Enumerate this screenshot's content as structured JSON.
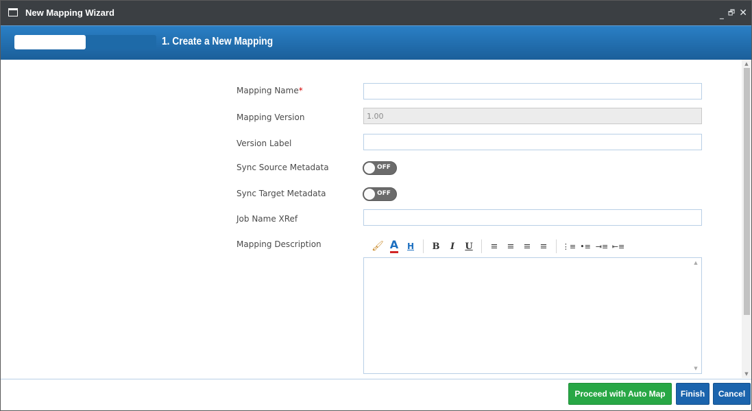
{
  "window": {
    "title": "New Mapping Wizard",
    "controls": {
      "minimize": "_",
      "restore": "🗗",
      "close": "✕"
    }
  },
  "wizard": {
    "step_title": "1. Create a New Mapping",
    "progress_fraction": 0.5
  },
  "form": {
    "mapping_name": {
      "label": "Mapping Name",
      "required_mark": "*",
      "value": ""
    },
    "mapping_version": {
      "label": "Mapping Version",
      "value": "1.00"
    },
    "version_label": {
      "label": "Version Label",
      "value": ""
    },
    "sync_source": {
      "label": "Sync Source Metadata",
      "state": "OFF"
    },
    "sync_target": {
      "label": "Sync Target Metadata",
      "state": "OFF"
    },
    "job_name_xref": {
      "label": "Job Name XRef",
      "value": ""
    },
    "mapping_description": {
      "label": "Mapping Description",
      "value": ""
    }
  },
  "editor_toolbar": {
    "buttons": [
      {
        "name": "paint-format-icon",
        "glyph": "🖌"
      },
      {
        "name": "font-color-icon",
        "glyph": "A"
      },
      {
        "name": "highlight-icon",
        "glyph": "H"
      },
      {
        "name": "bold-icon",
        "glyph": "B"
      },
      {
        "name": "italic-icon",
        "glyph": "I"
      },
      {
        "name": "underline-icon",
        "glyph": "U"
      },
      {
        "name": "align-left-icon",
        "glyph": "≡"
      },
      {
        "name": "align-center-icon",
        "glyph": "≡"
      },
      {
        "name": "align-right-icon",
        "glyph": "≡"
      },
      {
        "name": "justify-icon",
        "glyph": "≡"
      },
      {
        "name": "ordered-list-icon",
        "glyph": "⋮≡"
      },
      {
        "name": "bullet-list-icon",
        "glyph": "•≡"
      },
      {
        "name": "indent-icon",
        "glyph": "⇥≡"
      },
      {
        "name": "outdent-icon",
        "glyph": "⇤≡"
      }
    ]
  },
  "footer": {
    "auto_map_label": "Proceed with Auto Map",
    "finish_label": "Finish",
    "cancel_label": "Cancel"
  },
  "colors": {
    "titlebar": "#3b3f43",
    "banner": "#1f6db0",
    "auto_map_button": "#28a745",
    "primary_button": "#1b64ad",
    "required": "#d40000"
  }
}
